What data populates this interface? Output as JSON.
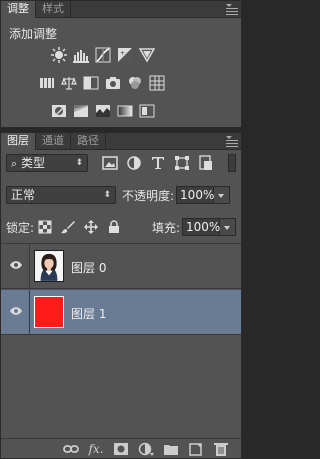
{
  "adjustments_panel": {
    "tabs": [
      {
        "label": "调整",
        "active": true
      },
      {
        "label": "样式",
        "active": false
      }
    ],
    "title": "添加调整",
    "rows": [
      [
        "brightness-contrast-icon",
        "levels-icon",
        "curves-icon",
        "exposure-icon",
        "vibrance-icon"
      ],
      [
        "hue-saturation-icon",
        "color-balance-icon",
        "black-white-icon",
        "photo-filter-icon",
        "channel-mixer-icon",
        "color-lookup-icon"
      ],
      [
        "invert-icon",
        "posterize-icon",
        "threshold-icon",
        "gradient-map-icon",
        "selective-color-icon"
      ]
    ]
  },
  "layers_panel": {
    "tabs": [
      {
        "label": "图层",
        "active": true
      },
      {
        "label": "通道",
        "active": false
      },
      {
        "label": "路径",
        "active": false
      }
    ],
    "filter": {
      "kind": "类型",
      "icons": [
        "pixel-filter-icon",
        "adjustment-filter-icon",
        "type-filter-icon",
        "shape-filter-icon",
        "smart-object-filter-icon"
      ]
    },
    "blend_mode": "正常",
    "opacity_label": "不透明度:",
    "opacity_value": "100%",
    "lock_label": "锁定:",
    "lock_icons": [
      "lock-transparent-icon",
      "lock-pixels-icon",
      "lock-position-icon",
      "lock-all-icon"
    ],
    "fill_label": "填充:",
    "fill_value": "100%",
    "layers": [
      {
        "name": "图层 0",
        "visible": true,
        "selected": false,
        "thumbnail": "portrait"
      },
      {
        "name": "图层 1",
        "visible": true,
        "selected": true,
        "thumbnail": "red-fill",
        "fill_color": "#ff1a1a"
      }
    ],
    "bottom_icons": [
      "link-layers-icon",
      "fx-icon",
      "add-mask-icon",
      "new-adjustment-icon",
      "new-group-icon",
      "new-layer-icon",
      "delete-layer-icon"
    ],
    "fx_label": "fx."
  },
  "colors": {
    "panel_bg": "#535353",
    "selected_layer": "#6a7c94",
    "red_layer": "#ff1a1a"
  }
}
